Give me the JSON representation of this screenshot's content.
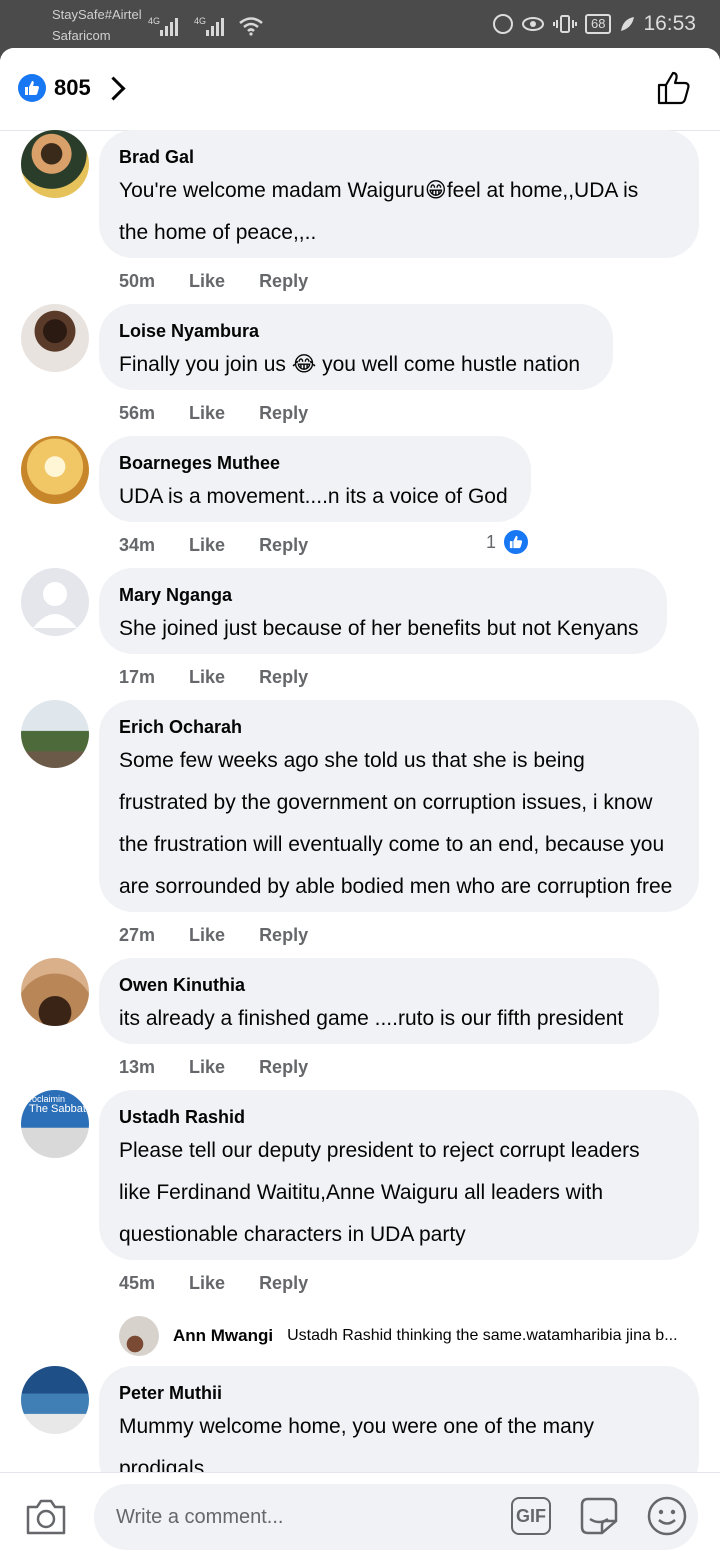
{
  "status_bar": {
    "carrier_1": "StaySafe#Airtel",
    "carrier_2": "Safaricom",
    "network_1": "4G",
    "network_2": "4G",
    "battery": "68",
    "time": "16:53"
  },
  "header": {
    "reaction_count": "805",
    "icons": [
      "like-reaction-icon",
      "chevron-right-icon",
      "thumbs-up-outline-icon"
    ]
  },
  "comments": [
    {
      "author": "Brad Gal",
      "lines": [
        "You're welcome madam Waiguru😁feel at home,,UDA is",
        "the home of peace,,.."
      ],
      "time": "50m",
      "like": "Like",
      "reply": "Reply"
    },
    {
      "author": "Loise Nyambura",
      "lines": [
        "Finally you join us 😂 you well come hustle nation"
      ],
      "time": "56m",
      "like": "Like",
      "reply": "Reply"
    },
    {
      "author": "Boarneges Muthee",
      "lines": [
        "UDA is a movement....n its a voice of God"
      ],
      "time": "34m",
      "like": "Like",
      "reply": "Reply",
      "reaction_count": "1"
    },
    {
      "author": "Mary Nganga",
      "lines": [
        "She joined just because of her benefits but not Kenyans"
      ],
      "time": "17m",
      "like": "Like",
      "reply": "Reply"
    },
    {
      "author": "Erich Ocharah",
      "lines": [
        "Some few weeks ago she told us that she is being",
        "frustrated by the government on corruption issues, i know",
        "the frustration will eventually come to an end, because you",
        "are sorrounded by able bodied men who are corruption free"
      ],
      "time": "27m",
      "like": "Like",
      "reply": "Reply"
    },
    {
      "author": "Owen Kinuthia",
      "lines": [
        "its already a finished game ....ruto is our fifth president"
      ],
      "time": "13m",
      "like": "Like",
      "reply": "Reply"
    },
    {
      "author": "Ustadh Rashid",
      "avatar_text": [
        "roclaimin",
        "The Sabbat"
      ],
      "lines": [
        "Please tell our deputy president to reject corrupt leaders",
        "like Ferdinand Waititu,Anne Waiguru all leaders with",
        "questionable characters in UDA party"
      ],
      "time": "45m",
      "like": "Like",
      "reply": "Reply",
      "reply_preview": {
        "author": "Ann Mwangi",
        "text": "Ustadh Rashid thinking the same.watamharibia jina b..."
      }
    },
    {
      "author": "Peter Muthii",
      "lines": [
        "Mummy welcome home, you were one of the many",
        "prodigals"
      ]
    }
  ],
  "composer": {
    "placeholder": "Write a comment...",
    "gif_label": "GIF",
    "icons": [
      "camera-icon",
      "gif-icon",
      "sticker-icon",
      "emoji-icon"
    ]
  }
}
